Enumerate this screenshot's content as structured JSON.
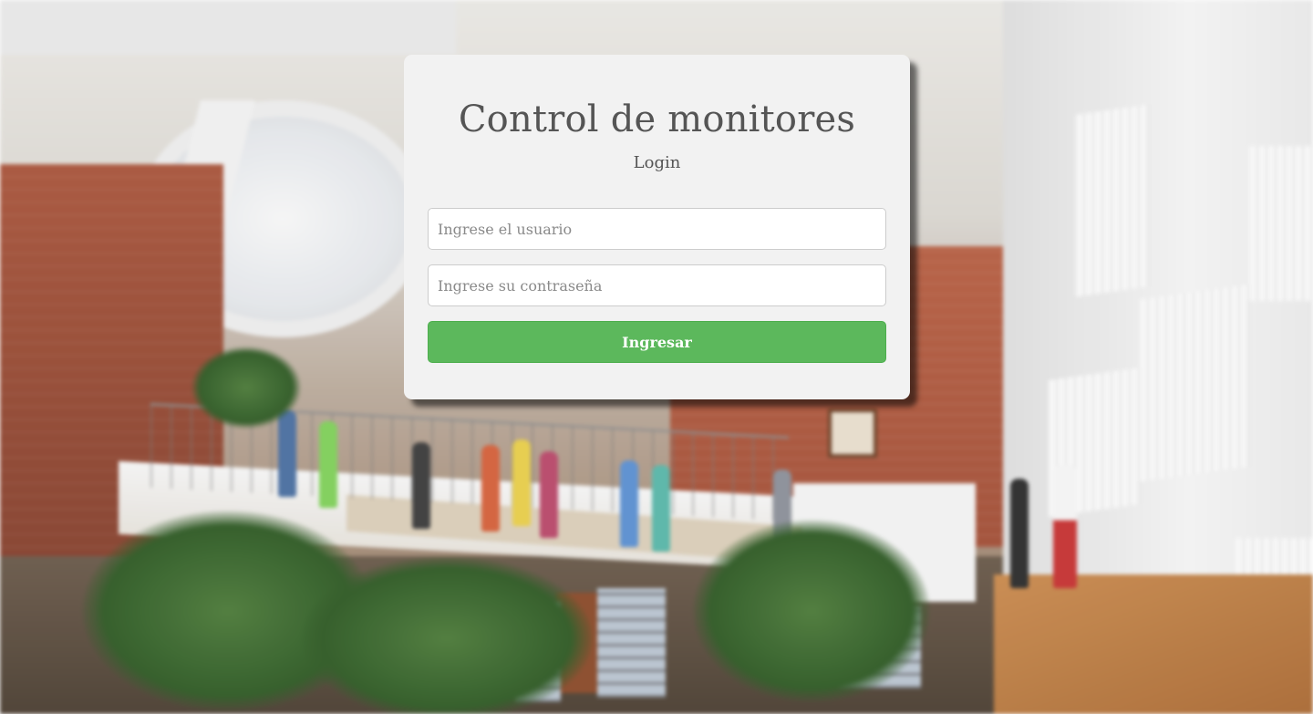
{
  "login": {
    "title": "Control de monitores",
    "subtitle": "Login",
    "username_placeholder": "Ingrese el usuario",
    "username_value": "",
    "password_placeholder": "Ingrese su contraseña",
    "password_value": "",
    "submit_label": "Ingresar"
  },
  "colors": {
    "card_background": "#f2f2f2",
    "title_text": "#555555",
    "button_background": "#5cb85c",
    "button_text": "#ffffff"
  },
  "background": {
    "image_description_icon": "library-photo-background"
  }
}
